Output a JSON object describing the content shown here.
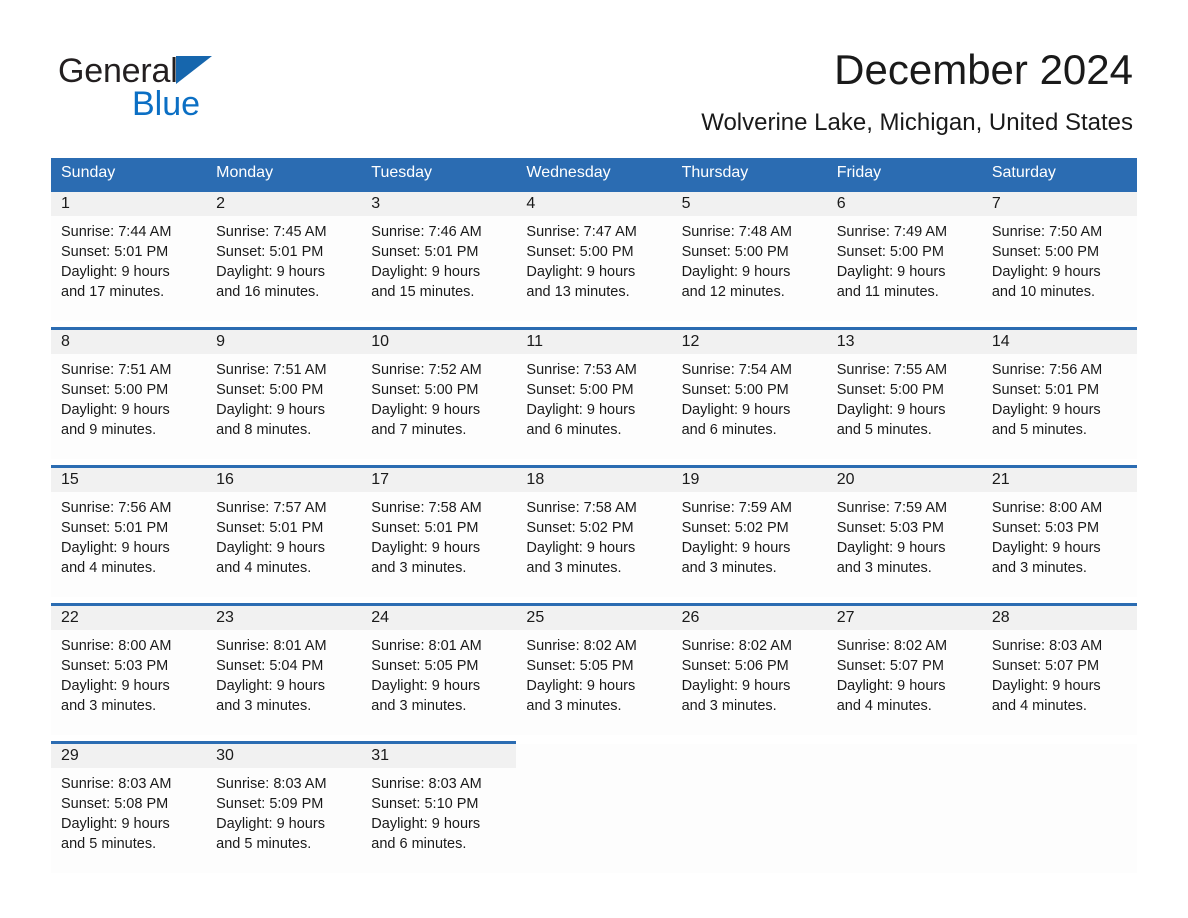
{
  "brand": {
    "name_part1": "General",
    "name_part2": "Blue",
    "triangle_color": "#1666ad",
    "blue_color": "#0b6fc4"
  },
  "header": {
    "title": "December 2024",
    "subtitle": "Wolverine Lake, Michigan, United States"
  },
  "theme": {
    "header_blue": "#2b6cb2",
    "daynum_band": "#f1f1f1",
    "cell_background": "#fdfdfd"
  },
  "calendar": {
    "weekday_headers": [
      "Sunday",
      "Monday",
      "Tuesday",
      "Wednesday",
      "Thursday",
      "Friday",
      "Saturday"
    ],
    "weeks": [
      [
        {
          "day": "1",
          "sunrise": "Sunrise: 7:44 AM",
          "sunset": "Sunset: 5:01 PM",
          "daylight_line1": "Daylight: 9 hours",
          "daylight_line2": "and 17 minutes."
        },
        {
          "day": "2",
          "sunrise": "Sunrise: 7:45 AM",
          "sunset": "Sunset: 5:01 PM",
          "daylight_line1": "Daylight: 9 hours",
          "daylight_line2": "and 16 minutes."
        },
        {
          "day": "3",
          "sunrise": "Sunrise: 7:46 AM",
          "sunset": "Sunset: 5:01 PM",
          "daylight_line1": "Daylight: 9 hours",
          "daylight_line2": "and 15 minutes."
        },
        {
          "day": "4",
          "sunrise": "Sunrise: 7:47 AM",
          "sunset": "Sunset: 5:00 PM",
          "daylight_line1": "Daylight: 9 hours",
          "daylight_line2": "and 13 minutes."
        },
        {
          "day": "5",
          "sunrise": "Sunrise: 7:48 AM",
          "sunset": "Sunset: 5:00 PM",
          "daylight_line1": "Daylight: 9 hours",
          "daylight_line2": "and 12 minutes."
        },
        {
          "day": "6",
          "sunrise": "Sunrise: 7:49 AM",
          "sunset": "Sunset: 5:00 PM",
          "daylight_line1": "Daylight: 9 hours",
          "daylight_line2": "and 11 minutes."
        },
        {
          "day": "7",
          "sunrise": "Sunrise: 7:50 AM",
          "sunset": "Sunset: 5:00 PM",
          "daylight_line1": "Daylight: 9 hours",
          "daylight_line2": "and 10 minutes."
        }
      ],
      [
        {
          "day": "8",
          "sunrise": "Sunrise: 7:51 AM",
          "sunset": "Sunset: 5:00 PM",
          "daylight_line1": "Daylight: 9 hours",
          "daylight_line2": "and 9 minutes."
        },
        {
          "day": "9",
          "sunrise": "Sunrise: 7:51 AM",
          "sunset": "Sunset: 5:00 PM",
          "daylight_line1": "Daylight: 9 hours",
          "daylight_line2": "and 8 minutes."
        },
        {
          "day": "10",
          "sunrise": "Sunrise: 7:52 AM",
          "sunset": "Sunset: 5:00 PM",
          "daylight_line1": "Daylight: 9 hours",
          "daylight_line2": "and 7 minutes."
        },
        {
          "day": "11",
          "sunrise": "Sunrise: 7:53 AM",
          "sunset": "Sunset: 5:00 PM",
          "daylight_line1": "Daylight: 9 hours",
          "daylight_line2": "and 6 minutes."
        },
        {
          "day": "12",
          "sunrise": "Sunrise: 7:54 AM",
          "sunset": "Sunset: 5:00 PM",
          "daylight_line1": "Daylight: 9 hours",
          "daylight_line2": "and 6 minutes."
        },
        {
          "day": "13",
          "sunrise": "Sunrise: 7:55 AM",
          "sunset": "Sunset: 5:00 PM",
          "daylight_line1": "Daylight: 9 hours",
          "daylight_line2": "and 5 minutes."
        },
        {
          "day": "14",
          "sunrise": "Sunrise: 7:56 AM",
          "sunset": "Sunset: 5:01 PM",
          "daylight_line1": "Daylight: 9 hours",
          "daylight_line2": "and 5 minutes."
        }
      ],
      [
        {
          "day": "15",
          "sunrise": "Sunrise: 7:56 AM",
          "sunset": "Sunset: 5:01 PM",
          "daylight_line1": "Daylight: 9 hours",
          "daylight_line2": "and 4 minutes."
        },
        {
          "day": "16",
          "sunrise": "Sunrise: 7:57 AM",
          "sunset": "Sunset: 5:01 PM",
          "daylight_line1": "Daylight: 9 hours",
          "daylight_line2": "and 4 minutes."
        },
        {
          "day": "17",
          "sunrise": "Sunrise: 7:58 AM",
          "sunset": "Sunset: 5:01 PM",
          "daylight_line1": "Daylight: 9 hours",
          "daylight_line2": "and 3 minutes."
        },
        {
          "day": "18",
          "sunrise": "Sunrise: 7:58 AM",
          "sunset": "Sunset: 5:02 PM",
          "daylight_line1": "Daylight: 9 hours",
          "daylight_line2": "and 3 minutes."
        },
        {
          "day": "19",
          "sunrise": "Sunrise: 7:59 AM",
          "sunset": "Sunset: 5:02 PM",
          "daylight_line1": "Daylight: 9 hours",
          "daylight_line2": "and 3 minutes."
        },
        {
          "day": "20",
          "sunrise": "Sunrise: 7:59 AM",
          "sunset": "Sunset: 5:03 PM",
          "daylight_line1": "Daylight: 9 hours",
          "daylight_line2": "and 3 minutes."
        },
        {
          "day": "21",
          "sunrise": "Sunrise: 8:00 AM",
          "sunset": "Sunset: 5:03 PM",
          "daylight_line1": "Daylight: 9 hours",
          "daylight_line2": "and 3 minutes."
        }
      ],
      [
        {
          "day": "22",
          "sunrise": "Sunrise: 8:00 AM",
          "sunset": "Sunset: 5:03 PM",
          "daylight_line1": "Daylight: 9 hours",
          "daylight_line2": "and 3 minutes."
        },
        {
          "day": "23",
          "sunrise": "Sunrise: 8:01 AM",
          "sunset": "Sunset: 5:04 PM",
          "daylight_line1": "Daylight: 9 hours",
          "daylight_line2": "and 3 minutes."
        },
        {
          "day": "24",
          "sunrise": "Sunrise: 8:01 AM",
          "sunset": "Sunset: 5:05 PM",
          "daylight_line1": "Daylight: 9 hours",
          "daylight_line2": "and 3 minutes."
        },
        {
          "day": "25",
          "sunrise": "Sunrise: 8:02 AM",
          "sunset": "Sunset: 5:05 PM",
          "daylight_line1": "Daylight: 9 hours",
          "daylight_line2": "and 3 minutes."
        },
        {
          "day": "26",
          "sunrise": "Sunrise: 8:02 AM",
          "sunset": "Sunset: 5:06 PM",
          "daylight_line1": "Daylight: 9 hours",
          "daylight_line2": "and 3 minutes."
        },
        {
          "day": "27",
          "sunrise": "Sunrise: 8:02 AM",
          "sunset": "Sunset: 5:07 PM",
          "daylight_line1": "Daylight: 9 hours",
          "daylight_line2": "and 4 minutes."
        },
        {
          "day": "28",
          "sunrise": "Sunrise: 8:03 AM",
          "sunset": "Sunset: 5:07 PM",
          "daylight_line1": "Daylight: 9 hours",
          "daylight_line2": "and 4 minutes."
        }
      ],
      [
        {
          "day": "29",
          "sunrise": "Sunrise: 8:03 AM",
          "sunset": "Sunset: 5:08 PM",
          "daylight_line1": "Daylight: 9 hours",
          "daylight_line2": "and 5 minutes."
        },
        {
          "day": "30",
          "sunrise": "Sunrise: 8:03 AM",
          "sunset": "Sunset: 5:09 PM",
          "daylight_line1": "Daylight: 9 hours",
          "daylight_line2": "and 5 minutes."
        },
        {
          "day": "31",
          "sunrise": "Sunrise: 8:03 AM",
          "sunset": "Sunset: 5:10 PM",
          "daylight_line1": "Daylight: 9 hours",
          "daylight_line2": "and 6 minutes."
        },
        {
          "day": "",
          "sunrise": "",
          "sunset": "",
          "daylight_line1": "",
          "daylight_line2": ""
        },
        {
          "day": "",
          "sunrise": "",
          "sunset": "",
          "daylight_line1": "",
          "daylight_line2": ""
        },
        {
          "day": "",
          "sunrise": "",
          "sunset": "",
          "daylight_line1": "",
          "daylight_line2": ""
        },
        {
          "day": "",
          "sunrise": "",
          "sunset": "",
          "daylight_line1": "",
          "daylight_line2": ""
        }
      ]
    ]
  }
}
